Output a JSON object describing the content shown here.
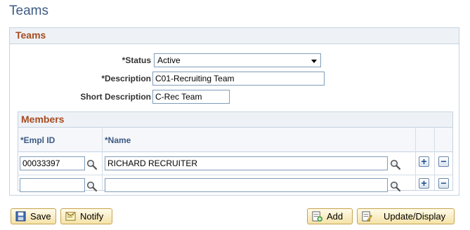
{
  "page": {
    "title": "Teams"
  },
  "group": {
    "title": "Teams"
  },
  "fields": {
    "status": {
      "label": "*Status",
      "value": "Active"
    },
    "description": {
      "label": "*Description",
      "value": "C01-Recruiting Team"
    },
    "short_description": {
      "label": "Short Description",
      "value": "C-Rec Team"
    }
  },
  "members": {
    "title": "Members",
    "columns": {
      "empl_id": "*Empl ID",
      "name": "*Name"
    },
    "rows": [
      {
        "empl_id": "00033397",
        "name": "RICHARD RECRUITER"
      },
      {
        "empl_id": "",
        "name": ""
      }
    ],
    "add_symbol": "+",
    "delete_symbol": "−"
  },
  "buttons": {
    "save": "Save",
    "notify": "Notify",
    "add": "Add",
    "update_display": "Update/Display"
  },
  "icons": {
    "lookup": "magnifier-icon",
    "save": "save-icon",
    "notify": "notify-icon",
    "add": "add-icon",
    "update": "update-display-icon"
  },
  "colors": {
    "title": "#3c5a84",
    "section_header": "#a74a20",
    "button_border": "#c7a24e"
  }
}
